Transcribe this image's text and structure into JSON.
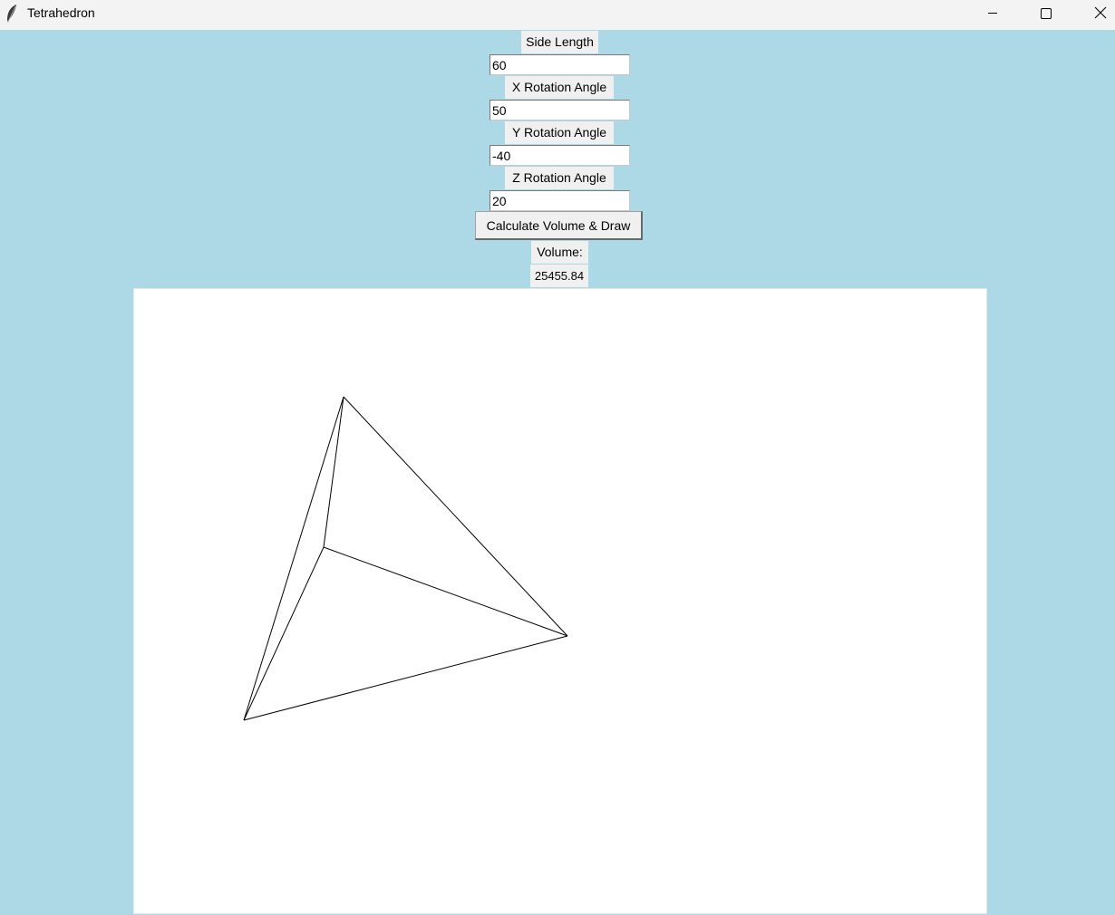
{
  "window": {
    "title": "Tetrahedron",
    "app_icon": "feather-icon",
    "controls": [
      "minimize-icon",
      "maximize-icon",
      "close-icon"
    ]
  },
  "form": {
    "side_length_label": "Side Length",
    "side_length_value": "60",
    "x_rotation_label": "X Rotation Angle",
    "x_rotation_value": "50",
    "y_rotation_label": "Y Rotation Angle",
    "y_rotation_value": "-40",
    "z_rotation_label": "Z Rotation Angle",
    "z_rotation_value": "20",
    "calculate_button_label": "Calculate Volume & Draw",
    "volume_label": "Volume:",
    "volume_value": "25455.84"
  },
  "colors": {
    "background": "#add8e6",
    "canvas": "#ffffff",
    "line": "#000000"
  }
}
